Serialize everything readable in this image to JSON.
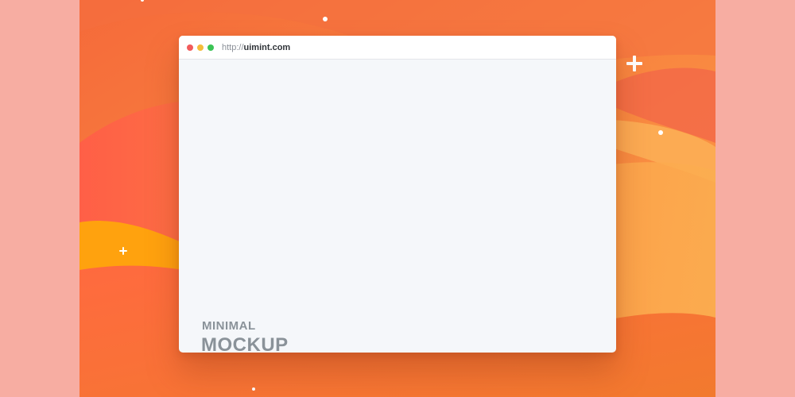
{
  "browser": {
    "url_scheme": "http://",
    "url_host": "uimint.com"
  },
  "content": {
    "headline_small": "MINIMAL",
    "headline_big": "MOCKUP"
  },
  "colors": {
    "outer_background": "#f7ada2",
    "traffic_red": "#f25b5b",
    "traffic_yellow": "#f5bd3a",
    "traffic_green": "#3bc455",
    "window_background": "#f5f7fa",
    "headline_text": "#8a9299"
  },
  "icons": [
    "close-dot-icon",
    "minimize-dot-icon",
    "maximize-dot-icon",
    "plus-sparkle-icon",
    "dot-sparkle-icon"
  ]
}
